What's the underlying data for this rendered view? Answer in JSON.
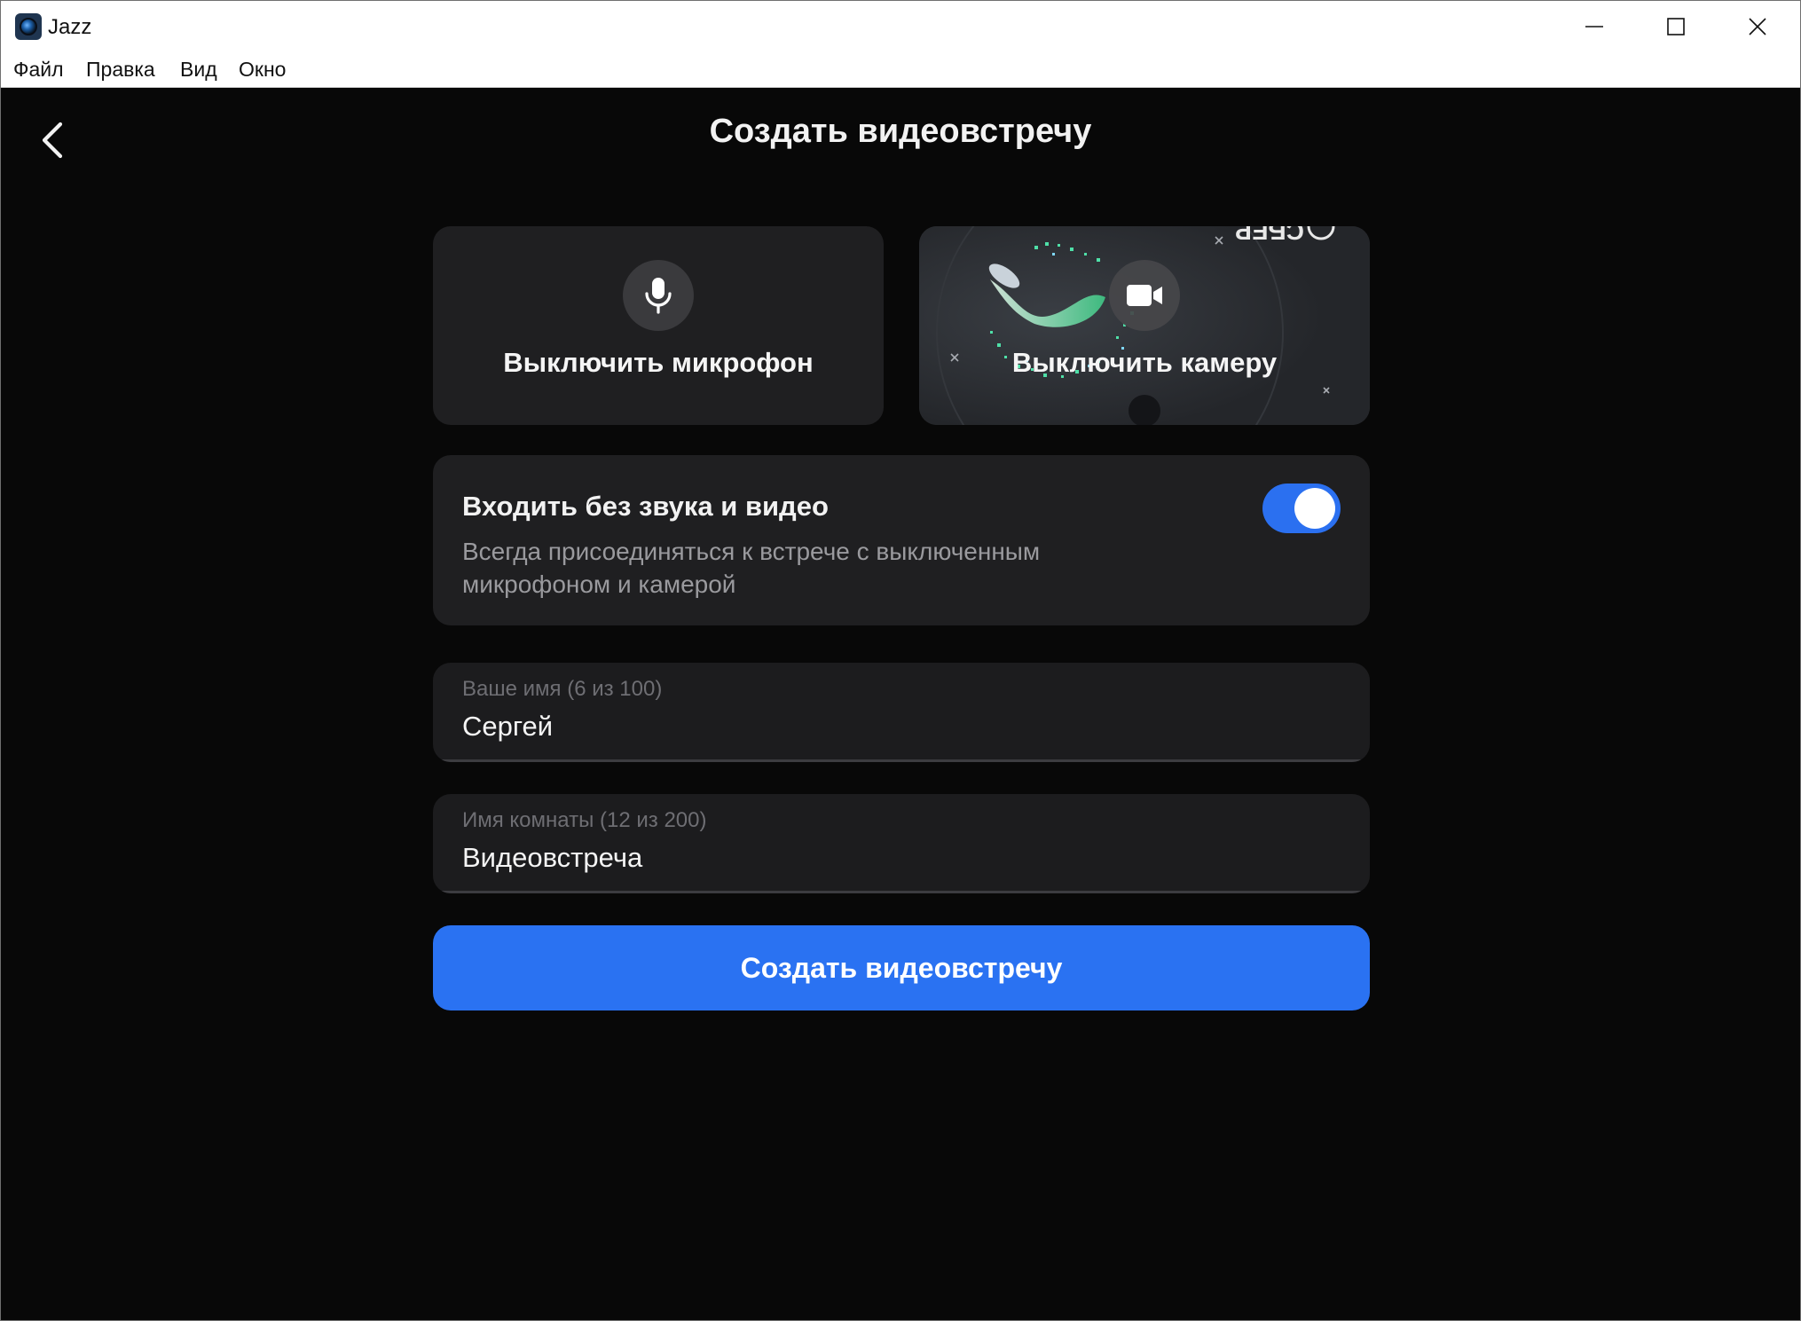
{
  "window": {
    "title": "Jazz"
  },
  "menu": {
    "items": [
      "Файл",
      "Правка",
      "Вид",
      "Окно"
    ]
  },
  "page": {
    "title": "Создать видеовстречу"
  },
  "mic_card": {
    "label": "Выключить микрофон",
    "icon": "microphone-icon"
  },
  "cam_card": {
    "label": "Выключить камеру",
    "icon": "video-camera-icon",
    "preview_text": "СБЕР"
  },
  "silent_join": {
    "title": "Входить без звука и видео",
    "description": "Всегда присоединяться к встрече с выключенным микрофоном и камерой",
    "enabled": true
  },
  "name_field": {
    "label": "Ваше имя (6 из 100)",
    "value": "Сергей"
  },
  "room_field": {
    "label": "Имя комнаты (12 из 200)",
    "value": "Видеовстреча"
  },
  "submit": {
    "label": "Создать видеовстречу"
  },
  "colors": {
    "accent": "#2a72f2",
    "background": "#080808",
    "card": "#1f1f21"
  }
}
